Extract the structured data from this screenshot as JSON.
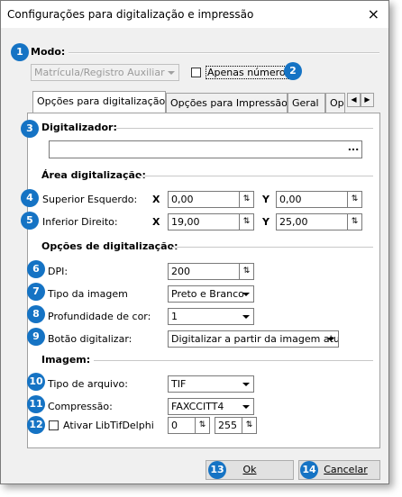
{
  "window": {
    "title": "Configurações para digitalização e impressão",
    "close_icon": "×"
  },
  "modo": {
    "badge": "1",
    "label": "Modo:",
    "select_value": "Matrícula/Registro Auxiliar",
    "badge2": "2",
    "apenas_numeros_label": "Apenas números"
  },
  "tabs": [
    "Opções para digitalização",
    "Opções para Impressão",
    "Geral",
    "Opç"
  ],
  "tab_scroll": {
    "left": "◀",
    "right": "▶"
  },
  "digitalizador": {
    "badge": "3",
    "label": "Digitalizador:",
    "value": "",
    "browse_label": "..."
  },
  "area": {
    "label": "Área digitalização:",
    "superior": {
      "badge": "4",
      "label": "Superior Esquerdo:",
      "x_label": "X",
      "x": "0,00",
      "y_label": "Y",
      "y": "0,00"
    },
    "inferior": {
      "badge": "5",
      "label": "Inferior Direito:",
      "x_label": "X",
      "x": "19,00",
      "y_label": "Y",
      "y": "25,00"
    }
  },
  "opcoes": {
    "label": "Opções de digitalização:",
    "dpi": {
      "badge": "6",
      "label": "DPI:",
      "value": "200"
    },
    "tipo_imagem": {
      "badge": "7",
      "label": "Tipo da imagem",
      "value": "Preto e Branco"
    },
    "profundidade": {
      "badge": "8",
      "label": "Profundidade de cor:",
      "value": "1"
    },
    "botao": {
      "badge": "9",
      "label": "Botão digitalizar:",
      "value": "Digitalizar a partir da imagem atual"
    }
  },
  "imagem": {
    "label": "Imagem:",
    "tipo_arquivo": {
      "badge": "10",
      "label": "Tipo de arquivo:",
      "value": "TIF"
    },
    "compressao": {
      "badge": "11",
      "label": "Compressão:",
      "value": "FAXCCITT4"
    },
    "libtif": {
      "badge": "12",
      "label": "Ativar LibTifDelphi",
      "value1": "0",
      "value2": "255"
    }
  },
  "buttons": {
    "ok_badge": "13",
    "ok_label": "Ok",
    "cancel_badge": "14",
    "cancel_label": "Cancelar"
  },
  "spin_icon": "⇅"
}
